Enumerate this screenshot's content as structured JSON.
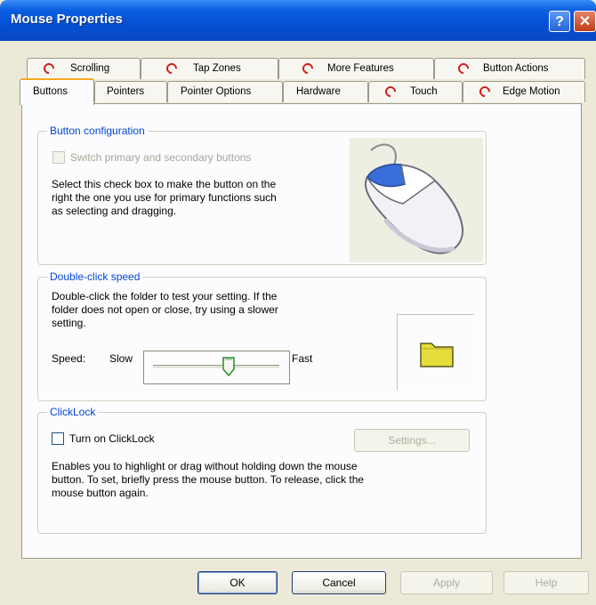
{
  "window": {
    "title": "Mouse Properties"
  },
  "titlebar": {
    "help_glyph": "?",
    "close_glyph": "✕"
  },
  "tabs_back": [
    {
      "label": "Scrolling",
      "icon": "synaptics-icon"
    },
    {
      "label": "Tap Zones",
      "icon": "synaptics-icon"
    },
    {
      "label": "More Features",
      "icon": "synaptics-icon"
    },
    {
      "label": "Button Actions",
      "icon": "synaptics-icon"
    }
  ],
  "tabs_front": [
    {
      "label": "Buttons",
      "active": true
    },
    {
      "label": "Pointers"
    },
    {
      "label": "Pointer Options"
    },
    {
      "label": "Hardware"
    },
    {
      "label": "Touch",
      "icon": "synaptics-icon"
    },
    {
      "label": "Edge Motion",
      "icon": "synaptics-icon"
    }
  ],
  "button_config": {
    "legend": "Button configuration",
    "switch_label": "Switch primary and secondary buttons",
    "switch_checked": false,
    "switch_enabled": false,
    "description_lines": [
      "Select this check box to make the button on the",
      "right the one you use for primary functions such",
      "as selecting and dragging."
    ]
  },
  "double_click": {
    "legend": "Double-click speed",
    "description_lines": [
      "Double-click the folder to test your setting. If the",
      "folder does not open or close, try using a slower",
      "setting."
    ],
    "speed_label": "Speed:",
    "slow_label": "Slow",
    "fast_label": "Fast",
    "speed_level": 0.6
  },
  "clicklock": {
    "legend": "ClickLock",
    "checkbox_label": "Turn on ClickLock",
    "checked": false,
    "settings_label": "Settings...",
    "description_lines": [
      "Enables you to highlight or drag without holding down the mouse",
      "button. To set, briefly press the mouse button. To release, click the",
      "mouse button again."
    ]
  },
  "footer": {
    "ok_label": "OK",
    "cancel_label": "Cancel",
    "apply_label": "Apply",
    "help_label": "Help"
  },
  "colors": {
    "accent": "#0046d5",
    "title_bar": "#0550d4",
    "tab_highlight": "#f6a823",
    "icon_red": "#d21c1c"
  }
}
